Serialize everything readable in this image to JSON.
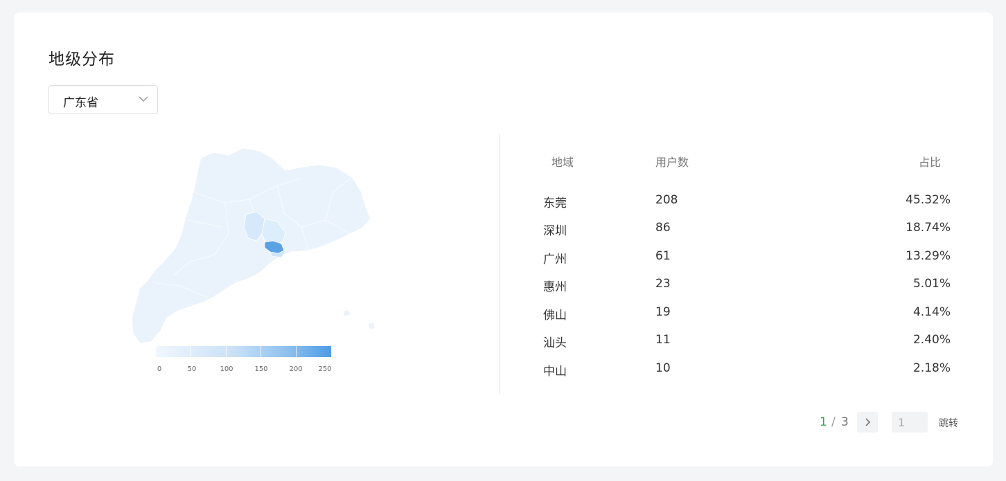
{
  "section": {
    "title": "地级分布"
  },
  "province_select": {
    "value": "广东省",
    "icon": "chevron-down-icon"
  },
  "map": {
    "legend_ticks": [
      "0",
      "50",
      "100",
      "150",
      "200",
      "250"
    ],
    "legend_range": [
      0,
      250
    ],
    "colors": {
      "low": "#f1f7fd",
      "high": "#4d9ce6"
    },
    "highlight_region": "东莞"
  },
  "table": {
    "headers": {
      "region": "地域",
      "users": "用户数",
      "ratio": "占比"
    },
    "rows": [
      {
        "region": "东莞",
        "users": "208",
        "ratio": "45.32%"
      },
      {
        "region": "深圳",
        "users": "86",
        "ratio": "18.74%"
      },
      {
        "region": "广州",
        "users": "61",
        "ratio": "13.29%"
      },
      {
        "region": "惠州",
        "users": "23",
        "ratio": "5.01%"
      },
      {
        "region": "佛山",
        "users": "19",
        "ratio": "4.14%"
      },
      {
        "region": "汕头",
        "users": "11",
        "ratio": "2.40%"
      },
      {
        "region": "中山",
        "users": "10",
        "ratio": "2.18%"
      }
    ]
  },
  "pagination": {
    "current": "1",
    "separator": "/",
    "total": "3",
    "next_icon": "chevron-right-icon",
    "jump_value": "1",
    "jump_label": "跳转",
    "accent": "#2aab4a"
  }
}
